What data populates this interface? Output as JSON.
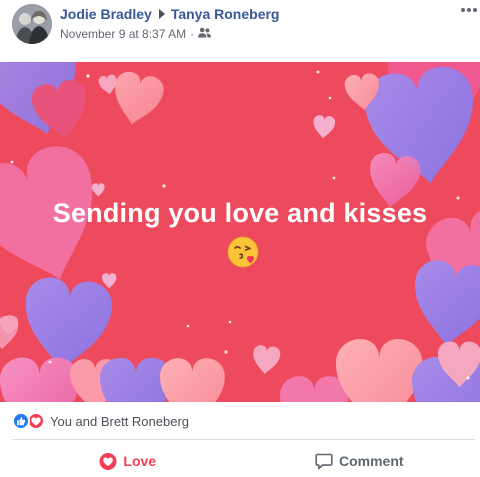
{
  "post": {
    "author": "Jodie Bradley",
    "recipient": "Tanya Roneberg",
    "timestamp": "November 9 at 8:37 AM",
    "separator": "·",
    "audience_icon": "friends-icon",
    "avatar": "profile-photo-two-people",
    "more_icon": "more-options-icon"
  },
  "banner": {
    "text": "Sending you love and kisses",
    "emoji": "face-blowing-kiss-emoji",
    "background_color": "#ed4a5e",
    "heart_colors": [
      "#9f80e6",
      "#f06ba6",
      "#fb9aa8",
      "#e8537b"
    ]
  },
  "reactions": {
    "icons": [
      "like-reaction-icon",
      "love-reaction-icon"
    ],
    "summary": "You and Brett Roneberg"
  },
  "actions": {
    "love_label": "Love",
    "comment_label": "Comment"
  },
  "colors": {
    "name_link": "#385898",
    "meta_text": "#616770",
    "love_red": "#f33e58",
    "like_blue": "#2078f4"
  }
}
